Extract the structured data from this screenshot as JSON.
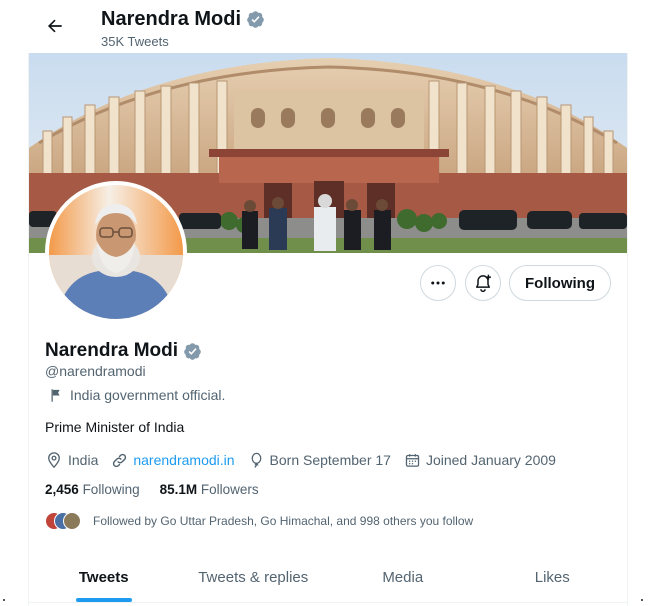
{
  "header": {
    "back_icon": "arrow-left-icon",
    "name": "Narendra Modi",
    "tweet_count": "35K Tweets",
    "verified_icon": "verified-badge-icon"
  },
  "actions": {
    "more_icon": "more-horizontal-icon",
    "notify_icon": "bell-plus-icon",
    "following_label": "Following"
  },
  "profile": {
    "name": "Narendra Modi",
    "handle": "@narendramodi",
    "label_icon": "flag-icon",
    "label": "India government official.",
    "bio": "Prime Minister of India",
    "location": "India",
    "website": "narendramodi.in",
    "birthday": "Born September 17",
    "joined": "Joined January 2009",
    "following_count": "2,456",
    "following_label": "Following",
    "followers_count": "85.1M",
    "followers_label": "Followers",
    "followed_by": "Followed by Go Uttar Pradesh, Go Himachal, and 998 others you follow"
  },
  "tabs": [
    {
      "label": "Tweets",
      "active": true
    },
    {
      "label": "Tweets & replies",
      "active": false
    },
    {
      "label": "Media",
      "active": false
    },
    {
      "label": "Likes",
      "active": false
    }
  ],
  "colors": {
    "accent": "#1d9bf0",
    "text_primary": "#0f1419",
    "text_secondary": "#536471",
    "verified_badge": "#829aab",
    "border": "#cfd9de"
  }
}
